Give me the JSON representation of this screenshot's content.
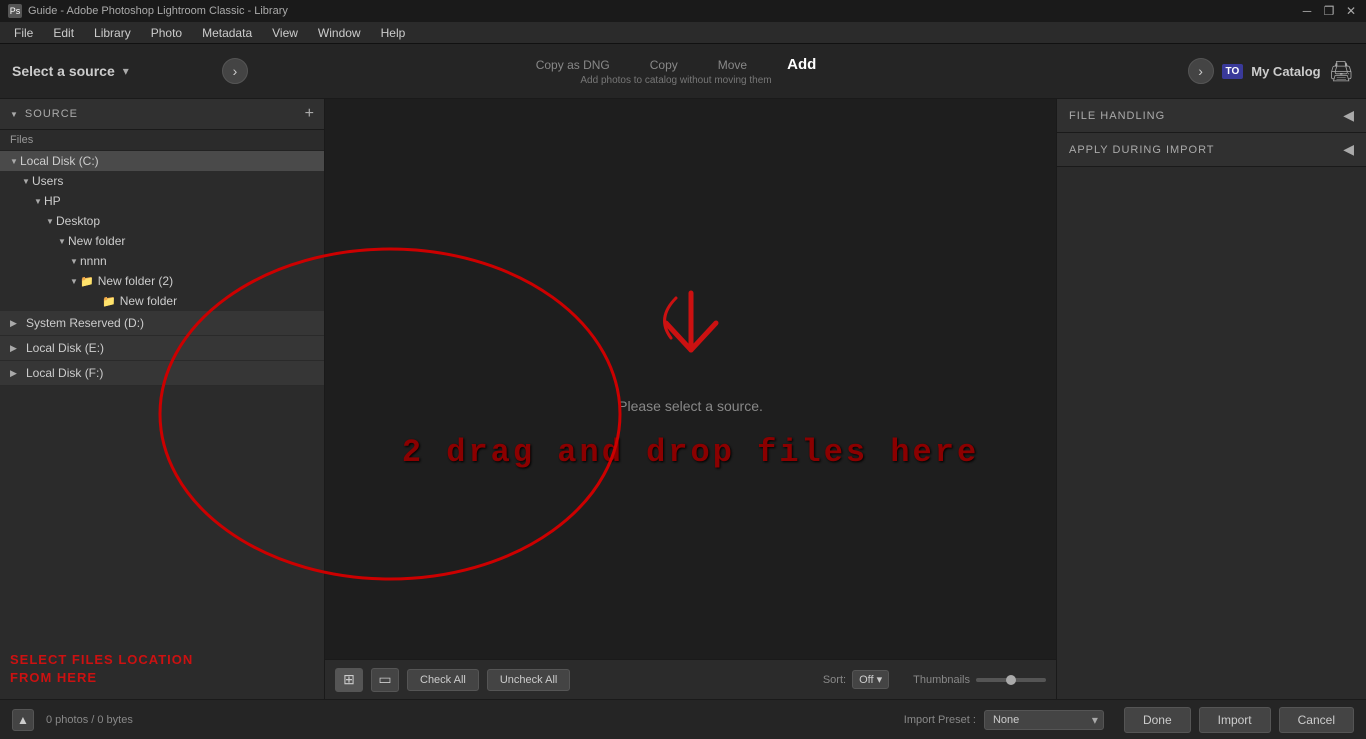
{
  "titlebar": {
    "icon": "Ps",
    "title": "Guide - Adobe Photoshop Lightroom Classic - Library"
  },
  "menubar": {
    "items": [
      "File",
      "Edit",
      "Library",
      "Photo",
      "Metadata",
      "View",
      "Window",
      "Help"
    ]
  },
  "header": {
    "source_label": "Select a source",
    "import_modes": [
      {
        "id": "copy_dng",
        "label": "Copy as DNG",
        "active": false
      },
      {
        "id": "copy",
        "label": "Copy",
        "active": false
      },
      {
        "id": "move",
        "label": "Move",
        "active": false
      },
      {
        "id": "add",
        "label": "Add",
        "active": true
      }
    ],
    "mode_subtitle": "Add photos to catalog without moving them",
    "dest_badge": "TO",
    "dest_label": "My Catalog"
  },
  "left_panel": {
    "title": "Source",
    "add_btn": "+",
    "file_label": "Files",
    "tree": [
      {
        "label": "Local Disk (C:)",
        "level": 0,
        "expanded": true,
        "selected": true
      },
      {
        "label": "Users",
        "level": 1,
        "expanded": true
      },
      {
        "label": "HP",
        "level": 2,
        "expanded": true
      },
      {
        "label": "Desktop",
        "level": 3,
        "expanded": true
      },
      {
        "label": "New folder",
        "level": 4,
        "expanded": true
      },
      {
        "label": "nnnn",
        "level": 5,
        "expanded": true
      },
      {
        "label": "New folder (2)",
        "level": 5,
        "expanded": false,
        "hasIcon": true
      },
      {
        "label": "New folder",
        "level": 6,
        "hasIcon": true
      }
    ],
    "disks": [
      {
        "label": "System Reserved (D:)",
        "expanded": false
      },
      {
        "label": "Local Disk (E:)",
        "expanded": false
      },
      {
        "label": "Local Disk (F:)",
        "expanded": false
      }
    ],
    "annotation": "SELECT FILES LOCATION\nFROM HERE"
  },
  "center_panel": {
    "please_select": "Please select a source.",
    "drag_drop": "2 drag and drop files here",
    "sort_label": "Sort:",
    "sort_value": "Off",
    "thumbnails_label": "Thumbnails",
    "check_all": "Check All",
    "uncheck_all": "Uncheck All"
  },
  "right_panel": {
    "file_handling_label": "File Handling",
    "apply_during_import_label": "Apply During Import"
  },
  "bottom_bar": {
    "photo_info": "0 photos / 0 bytes",
    "import_preset_label": "Import Preset :",
    "preset_value": "None",
    "done_btn": "Done",
    "import_btn": "Import",
    "cancel_btn": "Cancel"
  }
}
